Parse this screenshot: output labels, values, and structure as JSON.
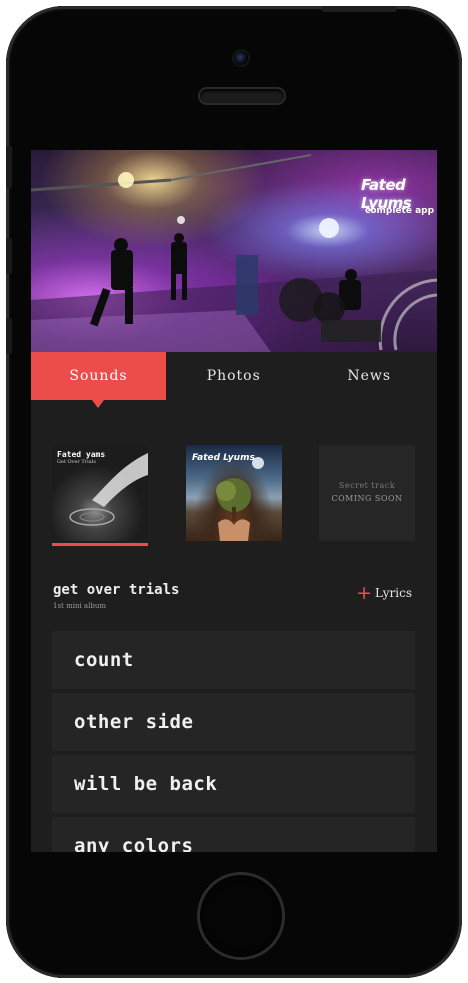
{
  "hero": {
    "logo_text": "Fated Lyums",
    "subtitle": "complete app"
  },
  "tabs": [
    {
      "label": "Sounds",
      "active": true
    },
    {
      "label": "Photos",
      "active": false
    },
    {
      "label": "News",
      "active": false
    }
  ],
  "albums": [
    {
      "cover_title": "Fated   yams",
      "cover_subtitle": "Get Over Trials",
      "selected": true
    },
    {
      "cover_title": "Fated Lyums",
      "selected": false
    },
    {
      "line1": "Secret track",
      "line2": "COMING SOON",
      "selected": false
    }
  ],
  "album": {
    "title": "get over trials",
    "subtitle": "1st mini album",
    "lyrics_label": "Lyrics"
  },
  "tracks": [
    "count",
    "other side",
    "will be back",
    "any colors"
  ],
  "colors": {
    "accent": "#ec4d4b",
    "background": "#1e1e1e",
    "row": "#252525"
  }
}
